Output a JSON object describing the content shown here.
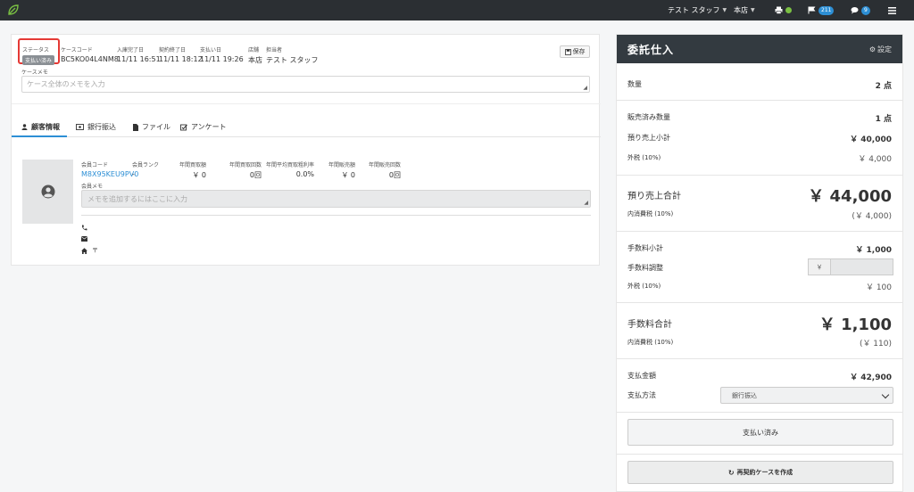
{
  "topbar": {
    "user": "テスト スタッフ",
    "store": "本店",
    "flag_count": "211",
    "comment_count": "9",
    "accent": "#2d8fd5",
    "status_dot": "#7ac043"
  },
  "case": {
    "status_label": "ステータス",
    "status_value": "支払い済み",
    "code_label": "ケースコード",
    "code_value": "BC5KO04L4NM8",
    "intake_label": "入庫完了日",
    "intake_value": "11/11 16:51",
    "contract_end_label": "契約終了日",
    "contract_end_value": "11/11 18:12",
    "payment_date_label": "支払い日",
    "payment_date_value": "11/11 19:26",
    "store_label": "店舗",
    "store_value": "本店",
    "staff_label": "担当者",
    "staff_value": "テスト スタッフ",
    "save_label": "保存",
    "memo_label": "ケースメモ",
    "memo_placeholder": "ケース全体のメモを入力"
  },
  "tabs": [
    {
      "label": "顧客情報",
      "icon": "user-icon"
    },
    {
      "label": "銀行振込",
      "icon": "money-icon"
    },
    {
      "label": "ファイル",
      "icon": "file-icon"
    },
    {
      "label": "アンケート",
      "icon": "check-square-icon"
    }
  ],
  "member": {
    "code_label": "会員コード",
    "code_value": "M8X95KEU9PV0",
    "rank_label": "会員ランク",
    "rank_value": "-",
    "annual_buy_amount_label": "年間買取額",
    "annual_buy_amount_value": "￥ 0",
    "annual_buy_count_label": "年間買取回数",
    "annual_buy_count_value": "0回",
    "annual_avg_margin_label": "年間平均買取粗利率",
    "annual_avg_margin_value": "0.0%",
    "annual_sales_amount_label": "年間販売額",
    "annual_sales_amount_value": "￥ 0",
    "annual_sales_count_label": "年間販売回数",
    "annual_sales_count_value": "0回",
    "memo_label": "会員メモ",
    "memo_placeholder": "メモを追加するにはここに入力",
    "postal_mark": "〒"
  },
  "consign": {
    "title": "委託仕入",
    "settings_label": "設定",
    "quantity_label": "数量",
    "quantity_value": "2 点",
    "sold_label": "販売済み数量",
    "sold_value": "1 点",
    "deposit_subtotal_label": "預り売上小計",
    "deposit_subtotal_value": "￥ 40,000",
    "tax_ex1_label": "外税 (10%)",
    "tax_ex1_value": "￥ 4,000",
    "deposit_total_label": "預り売上合計",
    "deposit_total_value": "￥ 44,000",
    "tax_in1_label": "内消費税 (10%)",
    "tax_in1_value": "(￥ 4,000)",
    "fee_subtotal_label": "手数料小計",
    "fee_subtotal_value": "￥ 1,000",
    "fee_adjust_label": "手数料調整",
    "fee_adjust_addon": "￥",
    "tax_ex2_label": "外税 (10%)",
    "tax_ex2_value": "￥ 100",
    "fee_total_label": "手数料合計",
    "fee_total_value": "￥ 1,100",
    "tax_in2_label": "内消費税 (10%)",
    "tax_in2_value": "(￥ 110)",
    "payment_amount_label": "支払金額",
    "payment_amount_value": "￥ 42,900",
    "payment_method_label": "支払方法",
    "payment_method_value": "銀行振込",
    "paid_button": "支払い済み",
    "recontract_button": "再契約ケースを作成"
  }
}
